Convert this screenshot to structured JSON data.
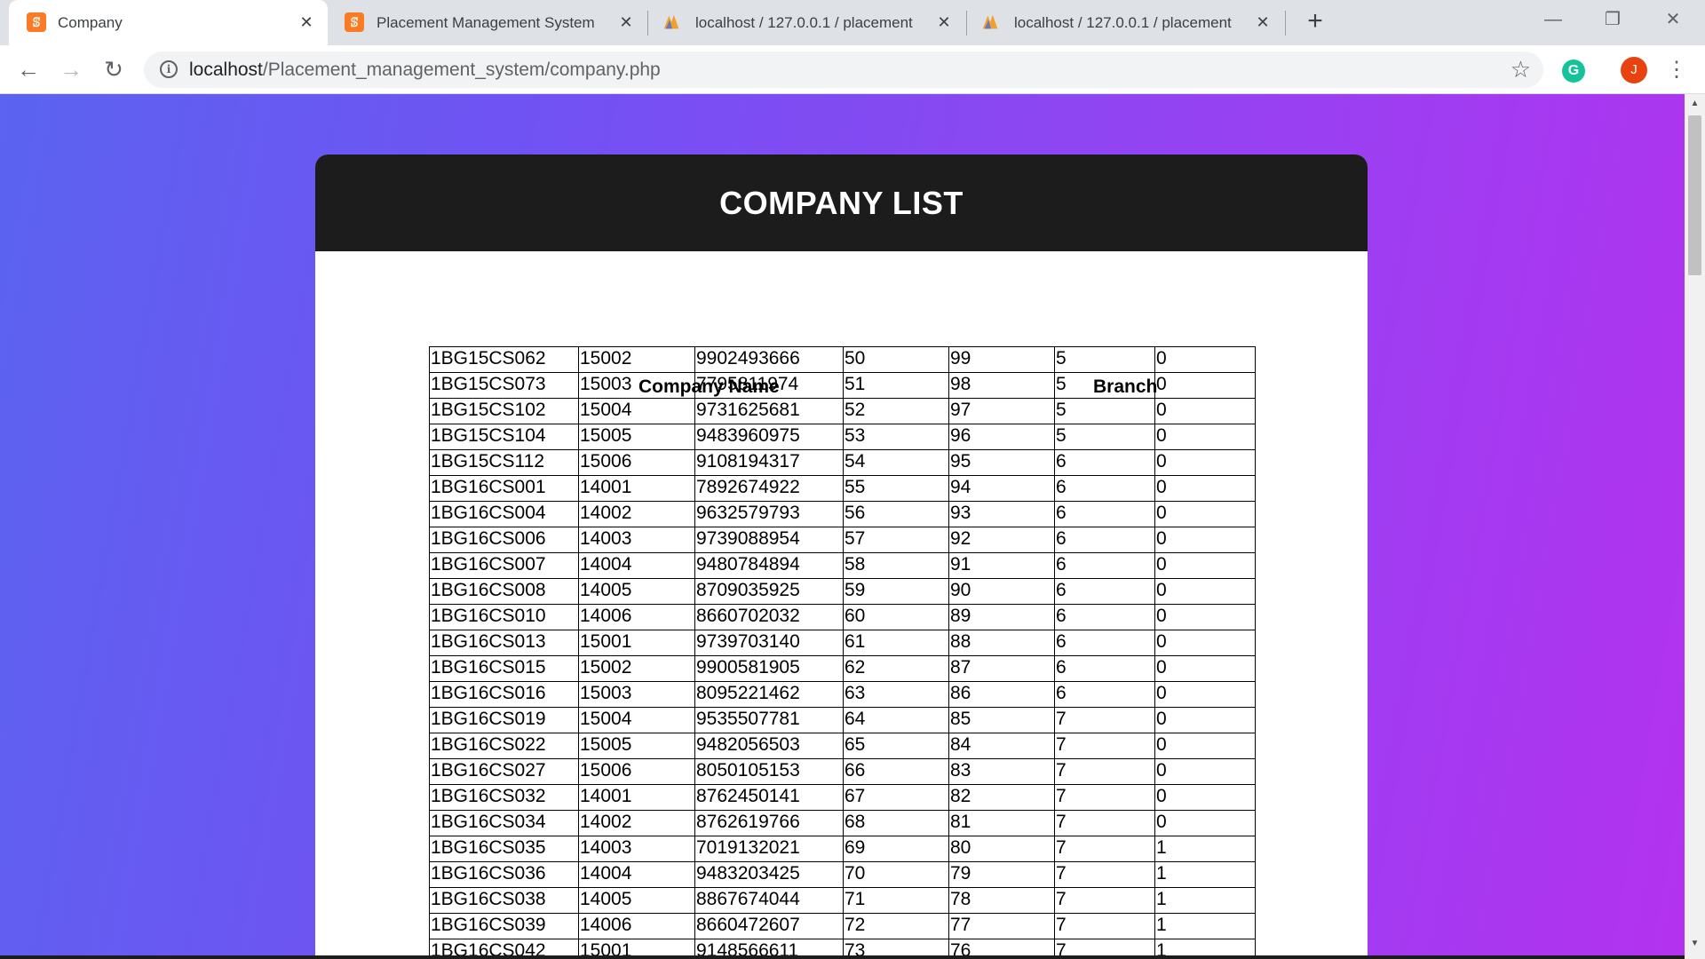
{
  "browser": {
    "tabs": [
      {
        "title": "Company",
        "favicon": "xampp-icon",
        "active": true
      },
      {
        "title": "Placement Management System",
        "favicon": "xampp-icon",
        "active": false
      },
      {
        "title": "localhost / 127.0.0.1 / placement",
        "favicon": "phpmyadmin-icon",
        "active": false
      },
      {
        "title": "localhost / 127.0.0.1 / placement",
        "favicon": "phpmyadmin-icon",
        "active": false
      }
    ],
    "new_tab_glyph": "+",
    "url_host": "localhost",
    "url_path": "/Placement_management_system/company.php",
    "extension_letter": "G",
    "profile_letter": "J"
  },
  "page": {
    "title": "COMPANY LIST",
    "headers": {
      "company_name": "Company Name",
      "branch": "Branch"
    },
    "rows": [
      [
        "1BG15CS062",
        "15002",
        "9902493666",
        "50",
        "99",
        "5",
        "0"
      ],
      [
        "1BG15CS073",
        "15003",
        "7795811974",
        "51",
        "98",
        "5",
        "0"
      ],
      [
        "1BG15CS102",
        "15004",
        "9731625681",
        "52",
        "97",
        "5",
        "0"
      ],
      [
        "1BG15CS104",
        "15005",
        "9483960975",
        "53",
        "96",
        "5",
        "0"
      ],
      [
        "1BG15CS112",
        "15006",
        "9108194317",
        "54",
        "95",
        "6",
        "0"
      ],
      [
        "1BG16CS001",
        "14001",
        "7892674922",
        "55",
        "94",
        "6",
        "0"
      ],
      [
        "1BG16CS004",
        "14002",
        "9632579793",
        "56",
        "93",
        "6",
        "0"
      ],
      [
        "1BG16CS006",
        "14003",
        "9739088954",
        "57",
        "92",
        "6",
        "0"
      ],
      [
        "1BG16CS007",
        "14004",
        "9480784894",
        "58",
        "91",
        "6",
        "0"
      ],
      [
        "1BG16CS008",
        "14005",
        "8709035925",
        "59",
        "90",
        "6",
        "0"
      ],
      [
        "1BG16CS010",
        "14006",
        "8660702032",
        "60",
        "89",
        "6",
        "0"
      ],
      [
        "1BG16CS013",
        "15001",
        "9739703140",
        "61",
        "88",
        "6",
        "0"
      ],
      [
        "1BG16CS015",
        "15002",
        "9900581905",
        "62",
        "87",
        "6",
        "0"
      ],
      [
        "1BG16CS016",
        "15003",
        "8095221462",
        "63",
        "86",
        "6",
        "0"
      ],
      [
        "1BG16CS019",
        "15004",
        "9535507781",
        "64",
        "85",
        "7",
        "0"
      ],
      [
        "1BG16CS022",
        "15005",
        "9482056503",
        "65",
        "84",
        "7",
        "0"
      ],
      [
        "1BG16CS027",
        "15006",
        "8050105153",
        "66",
        "83",
        "7",
        "0"
      ],
      [
        "1BG16CS032",
        "14001",
        "8762450141",
        "67",
        "82",
        "7",
        "0"
      ],
      [
        "1BG16CS034",
        "14002",
        "8762619766",
        "68",
        "81",
        "7",
        "0"
      ],
      [
        "1BG16CS035",
        "14003",
        "7019132021",
        "69",
        "80",
        "7",
        "1"
      ],
      [
        "1BG16CS036",
        "14004",
        "9483203425",
        "70",
        "79",
        "7",
        "1"
      ],
      [
        "1BG16CS038",
        "14005",
        "8867674044",
        "71",
        "78",
        "7",
        "1"
      ],
      [
        "1BG16CS039",
        "14006",
        "8660472607",
        "72",
        "77",
        "7",
        "1"
      ],
      [
        "1BG16CS042",
        "15001",
        "9148566611",
        "73",
        "76",
        "7",
        "1"
      ]
    ]
  }
}
